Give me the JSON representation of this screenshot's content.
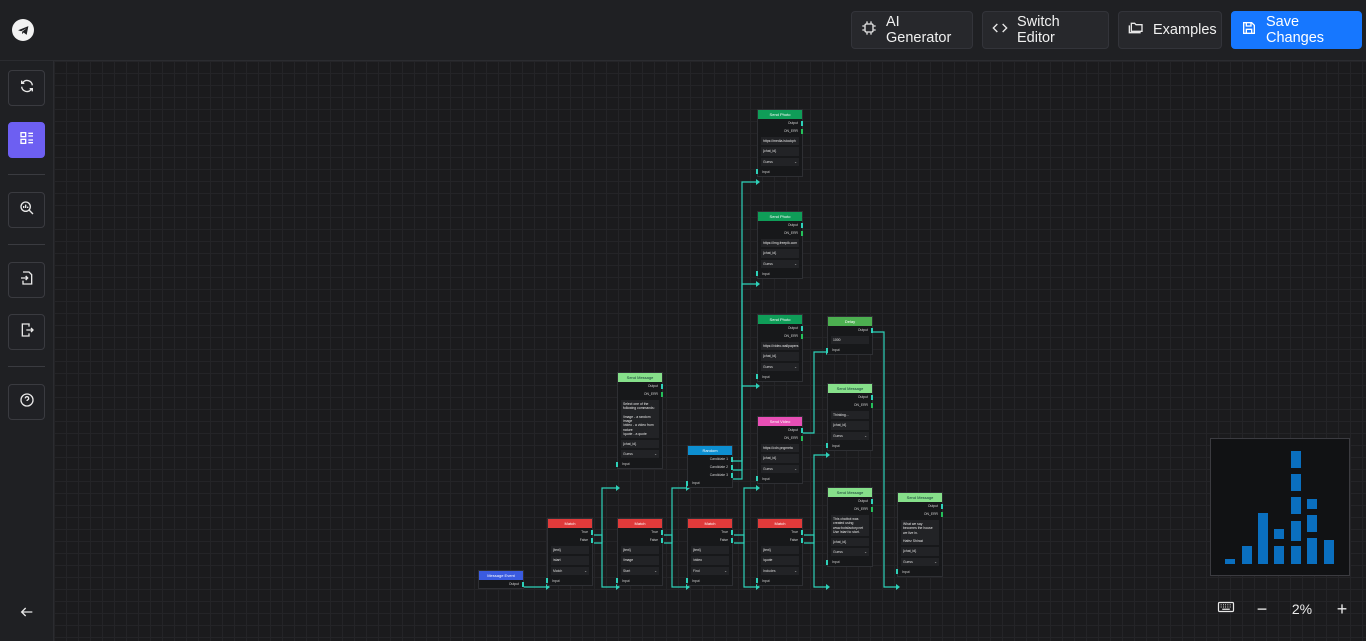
{
  "header": {
    "buttons": [
      {
        "label": "AI Generator",
        "icon": "chip-icon"
      },
      {
        "label": "Switch Editor",
        "icon": "code-icon"
      },
      {
        "label": "Examples",
        "icon": "folders-icon"
      },
      {
        "label": "Save Changes",
        "icon": "save-icon"
      }
    ]
  },
  "sidebar": {
    "items": [
      {
        "icon": "refresh-icon"
      },
      {
        "icon": "layout-icon",
        "active": true
      },
      {
        "icon": "search-chart-icon"
      },
      {
        "icon": "import-icon"
      },
      {
        "icon": "export-icon"
      },
      {
        "icon": "help-icon"
      },
      {
        "icon": "back-arrow-icon"
      }
    ]
  },
  "nodes": {
    "photo1": {
      "title": "Send Photo",
      "ports": [
        "Output",
        "ON_ERR"
      ],
      "fields": [
        "https://media.istockph",
        "{chat_id}"
      ],
      "select": "Guess",
      "input": "Input"
    },
    "photo2": {
      "title": "Send Photo",
      "ports": [
        "Output",
        "ON_ERR"
      ],
      "fields": [
        "https://img.freepik.com",
        "{chat_id}"
      ],
      "select": "Guess",
      "input": "Input"
    },
    "photo3": {
      "title": "Send Photo",
      "ports": [
        "Output",
        "ON_ERR"
      ],
      "fields": [
        "https://video.wallpapers",
        "{chat_id}"
      ],
      "select": "Guess",
      "input": "Input"
    },
    "video": {
      "title": "Send Video",
      "ports": [
        "Output",
        "ON_ERR"
      ],
      "fields": [
        "https://cdn.pngmeta",
        "{chat_id}"
      ],
      "select": "Guess",
      "input": "Input"
    },
    "delay": {
      "title": "Delay",
      "ports": [
        "Output"
      ],
      "fields": [
        "1000"
      ],
      "input": "Input"
    },
    "msg1": {
      "title": "Send Message",
      "ports": [
        "Output",
        "ON_ERR"
      ],
      "fields": [
        "Select one of the following commands:\n\n/image - a random image\n/video - a video from nature\n/quote - a quote",
        "{chat_id}"
      ],
      "select": "Guess",
      "input": "Input"
    },
    "msg2": {
      "title": "Send Message",
      "ports": [
        "Output",
        "ON_ERR"
      ],
      "fields": [
        "Thinking...",
        "{chat_id}"
      ],
      "select": "Guess",
      "input": "Input"
    },
    "msg3": {
      "title": "Send Message",
      "ports": [
        "Output",
        "ON_ERR"
      ],
      "fields": [
        "This chatbot was created using www.botsfactory.net Use /start to start.",
        "{chat_id}"
      ],
      "select": "Guess",
      "input": "Input"
    },
    "msg4": {
      "title": "Send Message",
      "ports": [
        "Output",
        "ON_ERR"
      ],
      "fields": [
        "What we say becomes the house we live in.\n\nHafez Shirazi",
        "{chat_id}"
      ],
      "select": "Guess",
      "input": "Input"
    },
    "random": {
      "title": "Random",
      "ports": [
        "Candidate 1",
        "Candidate 2",
        "Candidate 3"
      ],
      "input": "Input"
    },
    "match1": {
      "title": "Match",
      "ports": [
        "True",
        "False"
      ],
      "fields": [
        "{text}",
        "/start"
      ],
      "select": "Match",
      "input": "Input"
    },
    "match2": {
      "title": "Match",
      "ports": [
        "True",
        "False"
      ],
      "fields": [
        "{text}",
        "/image"
      ],
      "select": "Start",
      "input": "Input"
    },
    "match3": {
      "title": "Match",
      "ports": [
        "True",
        "False"
      ],
      "fields": [
        "{text}",
        "/video"
      ],
      "select": "Find",
      "input": "Input"
    },
    "match4": {
      "title": "Match",
      "ports": [
        "True",
        "False"
      ],
      "fields": [
        "{text}",
        "/quote"
      ],
      "select": "Includes",
      "input": "Input"
    },
    "event": {
      "title": "Message Event",
      "ports": [
        "Output"
      ]
    }
  },
  "zoom": {
    "value": "2%",
    "keyboard_icon": "keyboard-icon",
    "minus": "−",
    "plus": "+"
  },
  "colors": {
    "accent": "#1677ff",
    "active": "#6d5ff2",
    "edge": "#2ed1b9"
  }
}
